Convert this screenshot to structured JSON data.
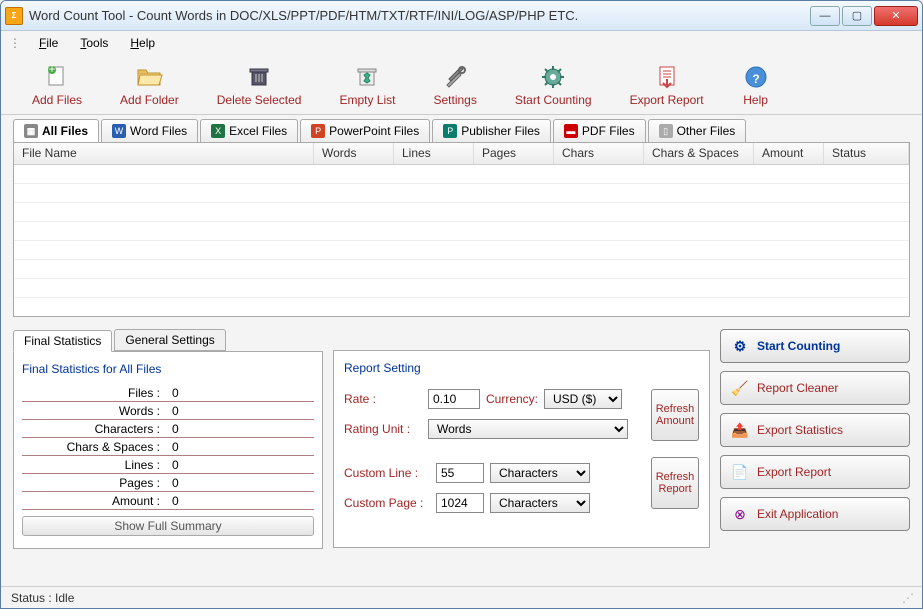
{
  "title": "Word Count Tool - Count Words in DOC/XLS/PPT/PDF/HTM/TXT/RTF/INI/LOG/ASP/PHP ETC.",
  "menu": {
    "file": "File",
    "tools": "Tools",
    "help": "Help"
  },
  "toolbar": {
    "add_files": "Add Files",
    "add_folder": "Add Folder",
    "delete_selected": "Delete Selected",
    "empty_list": "Empty List",
    "settings": "Settings",
    "start_counting": "Start Counting",
    "export_report": "Export Report",
    "help": "Help"
  },
  "filetabs": {
    "all": "All Files",
    "word": "Word Files",
    "excel": "Excel Files",
    "ppt": "PowerPoint Files",
    "pub": "Publisher Files",
    "pdf": "PDF Files",
    "other": "Other Files"
  },
  "columns": {
    "filename": "File Name",
    "words": "Words",
    "lines": "Lines",
    "pages": "Pages",
    "chars": "Chars",
    "chars_spaces": "Chars & Spaces",
    "amount": "Amount",
    "status": "Status"
  },
  "stats_tabs": {
    "final": "Final Statistics",
    "general": "General Settings"
  },
  "stats": {
    "title": "Final Statistics for All Files",
    "files_label": "Files :",
    "files": "0",
    "words_label": "Words :",
    "words": "0",
    "chars_label": "Characters :",
    "chars": "0",
    "cs_label": "Chars & Spaces :",
    "cs": "0",
    "lines_label": "Lines :",
    "lines": "0",
    "pages_label": "Pages :",
    "pages": "0",
    "amount_label": "Amount :",
    "amount": "0",
    "summary_btn": "Show Full Summary"
  },
  "report": {
    "title": "Report Setting",
    "rate_label": "Rate :",
    "rate": "0.10",
    "currency_label": "Currency:",
    "currency": "USD ($)",
    "rating_unit_label": "Rating Unit :",
    "rating_unit": "Words",
    "custom_line_label": "Custom Line :",
    "custom_line": "55",
    "custom_line_unit": "Characters",
    "custom_page_label": "Custom Page :",
    "custom_page": "1024",
    "custom_page_unit": "Characters",
    "refresh_amount": "Refresh Amount",
    "refresh_report": "Refresh Report"
  },
  "actions": {
    "start": "Start Counting",
    "cleaner": "Report Cleaner",
    "export_stats": "Export Statistics",
    "export_report": "Export Report",
    "exit": "Exit Application"
  },
  "status": "Status :  Idle"
}
